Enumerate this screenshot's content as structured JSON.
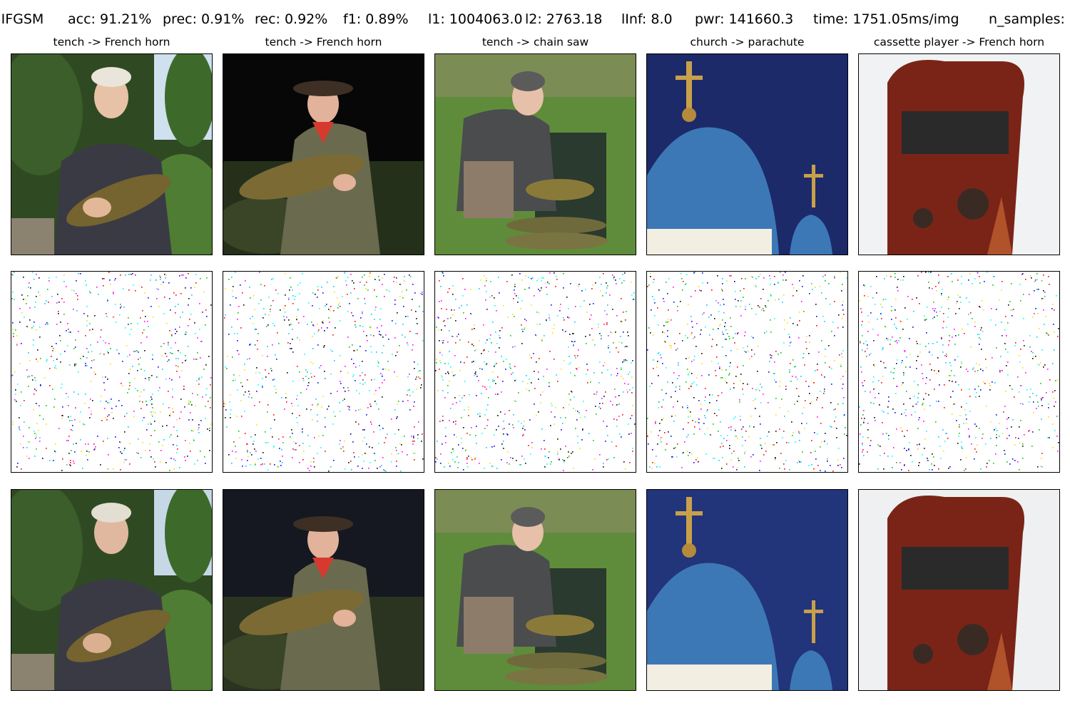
{
  "metrics": {
    "method": "IIFGSM",
    "acc": "acc: 91.21%",
    "prec": "prec: 0.91%",
    "rec": "rec: 0.92%",
    "f1": "f1: 0.89%",
    "l1": "l1: 1004063.0",
    "l2": "l2: 2763.18",
    "linf": "lInf: 8.0",
    "pwr": "pwr: 141660.3",
    "time": "time: 1751.05ms/img",
    "n_samples": "n_samples:"
  },
  "columns": [
    {
      "title": "tench -> French horn",
      "subject": "woman-holding-tench"
    },
    {
      "title": "tench -> French horn",
      "subject": "man-holding-tench-night"
    },
    {
      "title": "tench -> chain saw",
      "subject": "man-kneeling-with-tench"
    },
    {
      "title": "church -> parachute",
      "subject": "blue-church-dome"
    },
    {
      "title": "cassette player -> French horn",
      "subject": "red-cassette-player"
    }
  ],
  "rows": [
    "original-image",
    "perturbation",
    "adversarial-image"
  ],
  "colors": {
    "noise": [
      "#ff00ff",
      "#00c8ff",
      "#ffd800",
      "#00c800",
      "#0000ff",
      "#ff0000",
      "#000000",
      "#00ffff"
    ]
  }
}
